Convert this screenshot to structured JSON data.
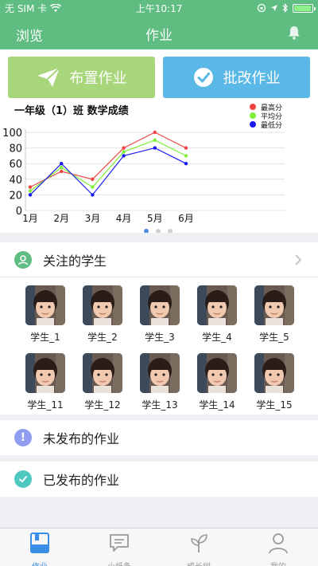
{
  "status_bar": {
    "carrier": "无 SIM 卡",
    "time": "上午10:17",
    "battery_level": 0.95
  },
  "navbar": {
    "left_label": "浏览",
    "title": "作业",
    "right_icon": "bell-icon"
  },
  "actions": {
    "assign_label": "布置作业",
    "grade_label": "批改作业",
    "assign_color": "#a8d67a",
    "grade_color": "#5ab8e6"
  },
  "chart_data": {
    "type": "line",
    "title": "一年级（1）班   数学成绩",
    "categories": [
      "1月",
      "2月",
      "3月",
      "4月",
      "5月",
      "6月"
    ],
    "ylim": [
      0,
      100
    ],
    "yticks": [
      0,
      20,
      40,
      60,
      80,
      100
    ],
    "grid": true,
    "legend_position": "top-right",
    "series": [
      {
        "name": "最高分",
        "color": "#ef4444",
        "values": [
          30,
          50,
          40,
          80,
          100,
          80
        ]
      },
      {
        "name": "平均分",
        "color": "#7fef3a",
        "values": [
          25,
          55,
          30,
          75,
          90,
          70
        ]
      },
      {
        "name": "最低分",
        "color": "#1a1aef",
        "values": [
          20,
          60,
          20,
          70,
          80,
          60
        ]
      }
    ],
    "page_dots": 3,
    "active_page": 0
  },
  "students_section": {
    "title": "关注的学生",
    "icon": "student-icon",
    "students": [
      "学生_1",
      "学生_2",
      "学生_3",
      "学生_4",
      "学生_5",
      "学生_11",
      "学生_12",
      "学生_13",
      "学生_14",
      "学生_15"
    ]
  },
  "unpublished": {
    "label": "未发布的作业",
    "icon": "exclamation-icon",
    "color": "#8f9ef0"
  },
  "published": {
    "label": "已发布的作业",
    "icon": "check-circle-icon",
    "color": "#4fc9c0"
  },
  "tabbar": {
    "tabs": [
      {
        "label": "作业",
        "icon": "homework-icon",
        "active": true
      },
      {
        "label": "小纸条",
        "icon": "chat-icon",
        "active": false
      },
      {
        "label": "成长树",
        "icon": "sprout-icon",
        "active": false
      },
      {
        "label": "我的",
        "icon": "profile-icon",
        "active": false
      }
    ],
    "active_color": "#3a8ee6"
  }
}
